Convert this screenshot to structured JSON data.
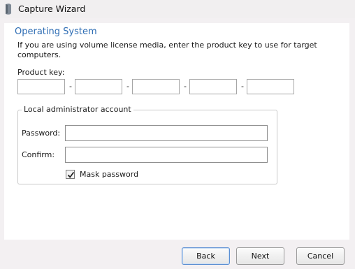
{
  "window": {
    "title": "Capture Wizard"
  },
  "section": {
    "title": "Operating System",
    "description": "If you are using volume license media, enter the product key to use for target computers."
  },
  "product_key": {
    "label": "Product key:",
    "segments": [
      "",
      "",
      "",
      "",
      ""
    ],
    "separator": "-"
  },
  "admin_account": {
    "legend": "Local administrator account",
    "password_label": "Password:",
    "password_value": "",
    "confirm_label": "Confirm:",
    "confirm_value": "",
    "mask_password_label": "Mask password",
    "mask_password_checked": true
  },
  "buttons": {
    "back": "Back",
    "next": "Next",
    "cancel": "Cancel"
  },
  "colors": {
    "accent": "#2e6db4",
    "panel": "#ffffff",
    "chrome": "#f3f0f2"
  }
}
